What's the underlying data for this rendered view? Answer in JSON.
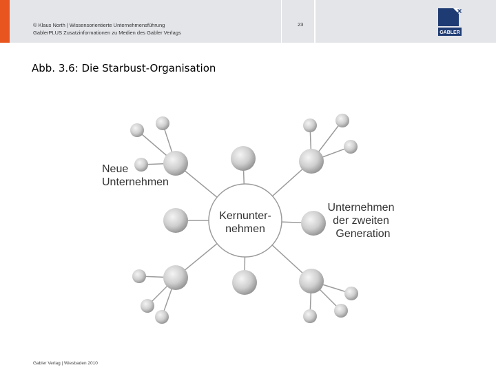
{
  "header": {
    "line1": "© Klaus North | Wissensorientierte Unternehmensführung",
    "line2": "GablerPLUS Zusatzinformationen zu Medien des Gabler Verlags",
    "page_number": "23",
    "logo_text": "GABLER"
  },
  "title": "Abb. 3.6: Die Starbust-Organisation",
  "diagram": {
    "center_label_line1": "Kernunter-",
    "center_label_line2": "nehmen",
    "left_label_line1": "Neue",
    "left_label_line2": "Unternehmen",
    "right_label_line1": "Unternehmen",
    "right_label_line2": "der zweiten",
    "right_label_line3": "Generation"
  },
  "footer": "Gabler Verlag | Wiesbaden 2010",
  "colors": {
    "accent": "#e8551e",
    "header_bg": "#e3e5e9",
    "logo_blue": "#1f3b73",
    "node_light": "#f2f2f2",
    "node_dark": "#9a9a9a",
    "line": "#9b9b9b"
  }
}
